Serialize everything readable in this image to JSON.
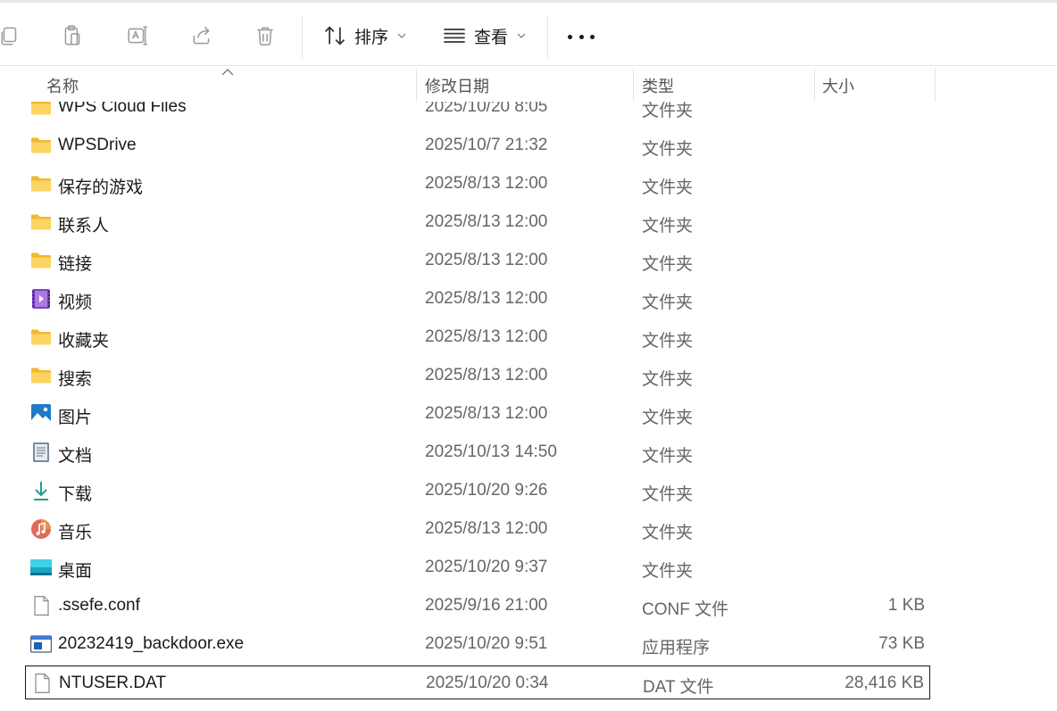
{
  "toolbar": {
    "sort_label": "排序",
    "view_label": "查看",
    "icons": [
      "copy-icon",
      "paste-icon",
      "rename-icon",
      "share-icon",
      "delete-icon",
      "sort-icon",
      "view-icon",
      "more-icon"
    ]
  },
  "columns": {
    "name": "名称",
    "date": "修改日期",
    "type": "类型",
    "size": "大小"
  },
  "files": [
    {
      "name": "WPS Cloud Files",
      "date": "2025/10/20 8:05",
      "type": "文件夹",
      "size": "",
      "icon": "folder-icon"
    },
    {
      "name": "WPSDrive",
      "date": "2025/10/7 21:32",
      "type": "文件夹",
      "size": "",
      "icon": "folder-icon"
    },
    {
      "name": "保存的游戏",
      "date": "2025/8/13 12:00",
      "type": "文件夹",
      "size": "",
      "icon": "folder-icon"
    },
    {
      "name": "联系人",
      "date": "2025/8/13 12:00",
      "type": "文件夹",
      "size": "",
      "icon": "folder-icon"
    },
    {
      "name": "链接",
      "date": "2025/8/13 12:00",
      "type": "文件夹",
      "size": "",
      "icon": "folder-icon"
    },
    {
      "name": "视频",
      "date": "2025/8/13 12:00",
      "type": "文件夹",
      "size": "",
      "icon": "videos-icon"
    },
    {
      "name": "收藏夹",
      "date": "2025/8/13 12:00",
      "type": "文件夹",
      "size": "",
      "icon": "folder-icon"
    },
    {
      "name": "搜索",
      "date": "2025/8/13 12:00",
      "type": "文件夹",
      "size": "",
      "icon": "folder-icon"
    },
    {
      "name": "图片",
      "date": "2025/8/13 12:00",
      "type": "文件夹",
      "size": "",
      "icon": "pictures-icon"
    },
    {
      "name": "文档",
      "date": "2025/10/13 14:50",
      "type": "文件夹",
      "size": "",
      "icon": "documents-icon"
    },
    {
      "name": "下载",
      "date": "2025/10/20 9:26",
      "type": "文件夹",
      "size": "",
      "icon": "downloads-icon"
    },
    {
      "name": "音乐",
      "date": "2025/8/13 12:00",
      "type": "文件夹",
      "size": "",
      "icon": "music-icon"
    },
    {
      "name": "桌面",
      "date": "2025/10/20 9:37",
      "type": "文件夹",
      "size": "",
      "icon": "desktop-icon"
    },
    {
      "name": ".ssefe.conf",
      "date": "2025/9/16 21:00",
      "type": "CONF 文件",
      "size": "1 KB",
      "icon": "file-icon"
    },
    {
      "name": "20232419_backdoor.exe",
      "date": "2025/10/20 9:51",
      "type": "应用程序",
      "size": "73 KB",
      "icon": "exe-icon"
    },
    {
      "name": "NTUSER.DAT",
      "date": "2025/10/20 0:34",
      "type": "DAT 文件",
      "size": "28,416 KB",
      "icon": "file-icon",
      "selected": true
    }
  ],
  "colors": {
    "folder": "#f7c74b",
    "accent": "#1f78c8",
    "selection_border": "#1a1a1a"
  }
}
